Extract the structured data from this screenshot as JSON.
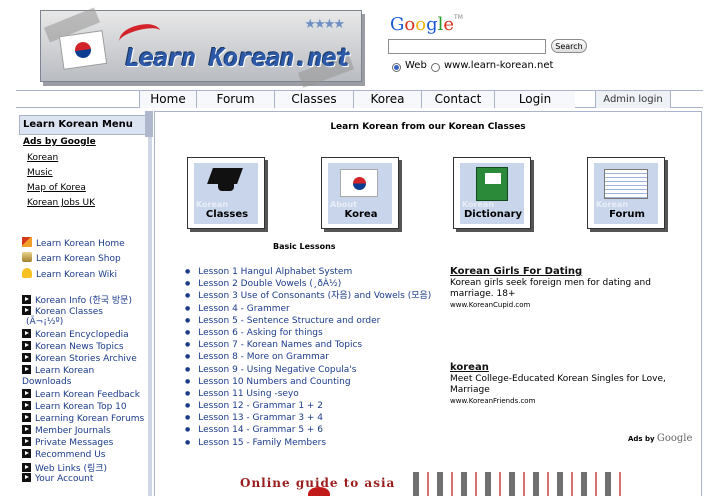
{
  "logo": {
    "text": "Learn Korean.net",
    "stars": "★★★★"
  },
  "google": {
    "letters": [
      "G",
      "o",
      "o",
      "g",
      "l",
      "e"
    ],
    "tm": "TM",
    "search_value": "",
    "search_button": "Search",
    "radio_web": "Web",
    "radio_site": "www.learn-korean.net"
  },
  "nav": {
    "items": [
      "Home",
      "Forum",
      "Classes",
      "Korea",
      "Contact",
      "Login",
      "Admin login"
    ]
  },
  "sidebar": {
    "title": "Learn Korean Menu",
    "ads_title": "Ads by Google",
    "ad_links": [
      "Korean",
      "Music",
      "Map of Korea",
      "Korean Jobs UK"
    ],
    "featured": [
      {
        "icon": "home-icon",
        "label": "Learn Korean Home"
      },
      {
        "icon": "shop-icon",
        "label": "Learn Korean Shop"
      },
      {
        "icon": "wiki-icon",
        "label": "Learn Korean Wiki"
      }
    ],
    "links": [
      "Korean Info (한국 방문)",
      "Korean Classes",
      "(Ã¬¡½º)",
      "Korean Encyclopedia",
      "Korean News Topics",
      "Korean Stories Archive",
      "Learn Korean",
      "Downloads",
      "Learn Korean Feedback",
      "Learn Korean Top 10",
      "Learning Korean Forums",
      "Member Journals",
      "Private Messages",
      "Recommend Us",
      "Web Links (링크)",
      "Your Account"
    ]
  },
  "main": {
    "title": "Learn Korean from our Korean Classes",
    "categories": [
      {
        "small": "Korean",
        "big": "Classes"
      },
      {
        "small": "About",
        "big": "Korea"
      },
      {
        "small": "Korean",
        "big": "Dictionary"
      },
      {
        "small": "Korean",
        "big": "Forum"
      }
    ],
    "basic_lessons_title": "Basic Lessons",
    "lessons": [
      "Lesson 1 Hangul Alphabet System",
      "Lesson 2 Double Vowels (¸ðÀ½)",
      "Lesson 3 Use of Consonants (자음) and Vowels (모음)",
      "Lesson 4 - Grammer",
      "Lesson 5 - Sentence Structure and order",
      "Lesson 6 - Asking for things",
      "Lesson 7 - Korean Names and Topics",
      "Lesson 8 - More on Grammar",
      "Lesson 9 - Using Negative Copula's",
      "Lesson 10 Numbers and Counting",
      "Lesson 11 Using -seyo",
      "Lesson 12 - Grammar 1 + 2",
      "Lesson 13 - Grammar 3 + 4",
      "Lesson 14 - Grammar 5 + 6",
      "Lesson 15 - Family Members"
    ],
    "ads": [
      {
        "head": "Korean Girls For Dating",
        "body": "Korean girls seek foreign men for dating and marriage. 18+",
        "url": "www.KoreanCupid.com"
      },
      {
        "head": "korean",
        "body": "Meet College-Educated Korean Singles for Love, Marriage",
        "url": "www.KoreanFriends.com"
      }
    ],
    "ads_by": "Ads by",
    "ads_by_brand": "Google",
    "banner_text": "Online guide to asia"
  }
}
